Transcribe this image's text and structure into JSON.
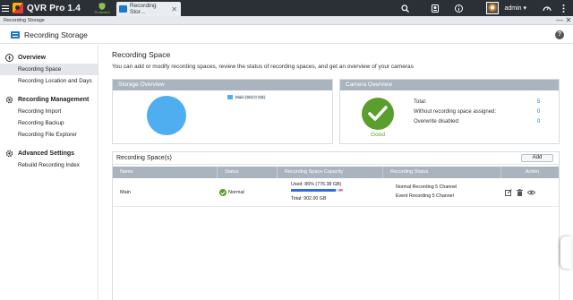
{
  "topbar": {
    "app_title": "QVR Pro 1.4",
    "protected_label": "Protected",
    "tab_label": "Recording Stor...",
    "tab_close": "✕",
    "username": "admin ▾"
  },
  "window": {
    "title": "Recording Storage",
    "minimize": "—",
    "close": "✕"
  },
  "app_header": {
    "title": "Recording Storage",
    "help": "?"
  },
  "sidebar": {
    "sections": [
      {
        "label": "Overview",
        "icon": "compass-icon",
        "items": [
          "Recording Space",
          "Recording Location and Days"
        ]
      },
      {
        "label": "Recording Management",
        "icon": "gear-icon",
        "items": [
          "Recording Import",
          "Recording Backup",
          "Recording File Explorer"
        ]
      },
      {
        "label": "Advanced Settings",
        "icon": "gear-icon",
        "items": [
          "Rebuild Recording Index"
        ]
      }
    ],
    "active": "Recording Space"
  },
  "main": {
    "title": "Recording Space",
    "description": "You can add or modify recording spaces, review the status of recording spaces, and get an overview of your cameras",
    "storage_overview": {
      "header": "Storage Overview",
      "legend": "Main (902.0 GB)",
      "color": "#4faef0"
    },
    "camera_overview": {
      "header": "Camera Overview",
      "status": "Good",
      "status_color": "#5a9f2e",
      "rows": [
        {
          "label": "Total:",
          "value": "5"
        },
        {
          "label": "Without recording space assigned:",
          "value": "0"
        },
        {
          "label": "Overwrite disabled:",
          "value": "0"
        }
      ]
    },
    "spaces": {
      "title": "Recording Space(s)",
      "add_label": "Add",
      "columns": [
        "Name",
        "Status",
        "Recording Space Capacity",
        "Recording Status",
        "Action"
      ],
      "rows": [
        {
          "name": "Main",
          "status": "Normal",
          "used": "Used: 86% (776.38 GB)",
          "used_fraction": 0.86,
          "total": "Total: 902.00 GB",
          "recording_status_1": "Normal Recording 5 Channel",
          "recording_status_2": "Event Recording 5 Channel"
        }
      ]
    }
  }
}
